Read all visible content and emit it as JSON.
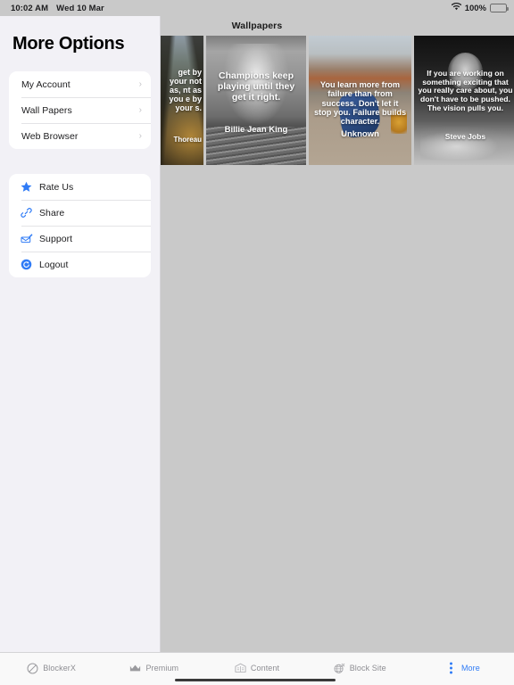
{
  "status_bar": {
    "time": "10:02 AM",
    "date": "Wed 10 Mar",
    "battery_percent": "100%",
    "wifi_icon": "wifi-icon",
    "battery_icon": "battery-full-icon"
  },
  "sidebar": {
    "title": "More Options",
    "group_one": [
      {
        "label": "My Account",
        "chevron": "›"
      },
      {
        "label": "Wall Papers",
        "chevron": "›"
      },
      {
        "label": "Web Browser",
        "chevron": "›"
      }
    ],
    "group_two": [
      {
        "label": "Rate Us",
        "icon": "star-icon"
      },
      {
        "label": "Share",
        "icon": "link-icon"
      },
      {
        "label": "Support",
        "icon": "support-ticket-icon"
      },
      {
        "label": "Logout",
        "icon": "logout-icon"
      }
    ],
    "accent_color": "#2f7bf6"
  },
  "main": {
    "title": "Wallpapers",
    "wallpapers": [
      {
        "quote": "get by\nyour\nnot as,\nnt as\nyou\ne by\nyour\ns.",
        "author": "Thoreau"
      },
      {
        "quote": "Champions keep playing until they get it right.",
        "author": "Billie Jean King"
      },
      {
        "quote": "You learn more from failure than from success. Don't let it stop you. Failure builds character.",
        "author": "Unknown"
      },
      {
        "quote": "If you are working on something exciting that you really care about, you don't have to be pushed. The vision pulls you.",
        "author": "Steve Jobs"
      }
    ]
  },
  "tab_bar": {
    "tabs": [
      {
        "label": "BlockerX",
        "icon": "block-circle-icon",
        "active": false
      },
      {
        "label": "Premium",
        "icon": "crown-icon",
        "active": false
      },
      {
        "label": "Content",
        "icon": "book-icon",
        "active": false
      },
      {
        "label": "Block Site",
        "icon": "globe-x-icon",
        "active": false
      },
      {
        "label": "More",
        "icon": "more-vertical-icon",
        "active": true
      }
    ],
    "active_color": "#2f7bf6",
    "inactive_color": "#8e8e93"
  }
}
